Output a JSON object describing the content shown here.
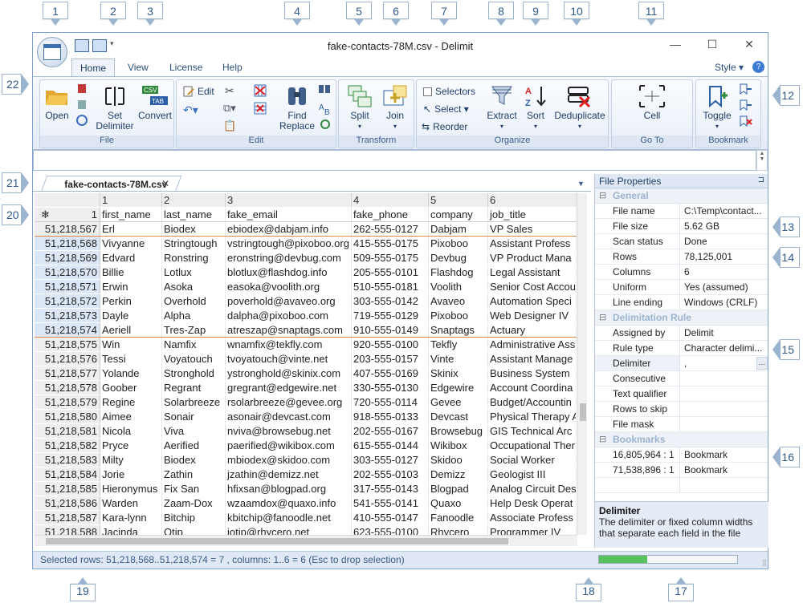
{
  "callouts": [
    "1",
    "2",
    "3",
    "4",
    "5",
    "6",
    "7",
    "8",
    "9",
    "10",
    "11",
    "12",
    "13",
    "14",
    "15",
    "16",
    "17",
    "18",
    "19",
    "20",
    "21",
    "22"
  ],
  "window": {
    "title": "fake-contacts-78M.csv - Delimit",
    "minimize": "—",
    "maximize": "☐",
    "close": "✕"
  },
  "tabs": {
    "home": "Home",
    "view": "View",
    "license": "License",
    "help": "Help",
    "style": "Style ▾",
    "help_icon": "?"
  },
  "ribbon": {
    "file": {
      "name": "File",
      "open": "Open",
      "set_delimiter_1": "Set",
      "set_delimiter_2": "Delimiter",
      "convert": "Convert"
    },
    "edit": {
      "name": "Edit",
      "edit": "Edit",
      "find_replace_1": "Find",
      "find_replace_2": "Replace"
    },
    "transform": {
      "name": "Transform",
      "split": "Split",
      "join": "Join"
    },
    "organize": {
      "name": "Organize",
      "selectors": "Selectors",
      "select": "Select ▾",
      "reorder": "Reorder",
      "extract": "Extract",
      "sort": "Sort",
      "deduplicate": "Deduplicate"
    },
    "goto": {
      "name": "Go To",
      "cell": "Cell"
    },
    "bookmark": {
      "name": "Bookmark",
      "toggle": "Toggle"
    }
  },
  "document_tab": {
    "label": "fake-contacts-78M.csv",
    "close": "✕"
  },
  "grid": {
    "col_numbers": [
      "",
      "1",
      "2",
      "3",
      "4",
      "5",
      "6"
    ],
    "header_row": {
      "num": "1",
      "cells": [
        "first_name",
        "last_name",
        "fake_email",
        "fake_phone",
        "company",
        "job_title"
      ]
    },
    "rows": [
      {
        "num": "51,218,567",
        "cells": [
          "Erl",
          "Biodex",
          "ebiodex@dabjam.info",
          "262-555-0127",
          "Dabjam",
          "VP Sales"
        ]
      },
      {
        "num": "51,218,568",
        "cells": [
          "Vivyanne",
          "Stringtough",
          "vstringtough@pixoboo.org",
          "415-555-0175",
          "Pixoboo",
          "Assistant Profess"
        ]
      },
      {
        "num": "51,218,569",
        "cells": [
          "Edvard",
          "Ronstring",
          "eronstring@devbug.com",
          "509-555-0175",
          "Devbug",
          "VP Product Mana"
        ]
      },
      {
        "num": "51,218,570",
        "cells": [
          "Billie",
          "Lotlux",
          "blotlux@flashdog.info",
          "205-555-0101",
          "Flashdog",
          "Legal Assistant"
        ]
      },
      {
        "num": "51,218,571",
        "cells": [
          "Erwin",
          "Asoka",
          "easoka@voolith.org",
          "510-555-0181",
          "Voolith",
          "Senior Cost Accou"
        ]
      },
      {
        "num": "51,218,572",
        "cells": [
          "Perkin",
          "Overhold",
          "poverhold@avaveo.org",
          "303-555-0142",
          "Avaveo",
          "Automation Speci"
        ]
      },
      {
        "num": "51,218,573",
        "cells": [
          "Dayle",
          "Alpha",
          "dalpha@pixoboo.com",
          "719-555-0129",
          "Pixoboo",
          "Web Designer IV"
        ]
      },
      {
        "num": "51,218,574",
        "cells": [
          "Aeriell",
          "Tres-Zap",
          "atreszap@snaptags.com",
          "910-555-0149",
          "Snaptags",
          "Actuary"
        ]
      },
      {
        "num": "51,218,575",
        "cells": [
          "Win",
          "Namfix",
          "wnamfix@tekfly.com",
          "920-555-0100",
          "Tekfly",
          "Administrative Ass"
        ]
      },
      {
        "num": "51,218,576",
        "cells": [
          "Tessi",
          "Voyatouch",
          "tvoyatouch@vinte.net",
          "203-555-0157",
          "Vinte",
          "Assistant Manage"
        ]
      },
      {
        "num": "51,218,577",
        "cells": [
          "Yolande",
          "Stronghold",
          "ystronghold@skinix.com",
          "407-555-0169",
          "Skinix",
          "Business System"
        ]
      },
      {
        "num": "51,218,578",
        "cells": [
          "Goober",
          "Regrant",
          "gregrant@edgewire.net",
          "330-555-0130",
          "Edgewire",
          "Account Coordina"
        ]
      },
      {
        "num": "51,218,579",
        "cells": [
          "Regine",
          "Solarbreeze",
          "rsolarbreeze@gevee.org",
          "720-555-0114",
          "Gevee",
          "Budget/Accountin"
        ]
      },
      {
        "num": "51,218,580",
        "cells": [
          "Aimee",
          "Sonair",
          "asonair@devcast.com",
          "918-555-0133",
          "Devcast",
          "Physical Therapy A"
        ]
      },
      {
        "num": "51,218,581",
        "cells": [
          "Nicola",
          "Viva",
          "nviva@browsebug.net",
          "202-555-0167",
          "Browsebug",
          "GIS Technical Arc"
        ]
      },
      {
        "num": "51,218,582",
        "cells": [
          "Pryce",
          "Aerified",
          "paerified@wikibox.com",
          "615-555-0144",
          "Wikibox",
          "Occupational Ther"
        ]
      },
      {
        "num": "51,218,583",
        "cells": [
          "Milty",
          "Biodex",
          "mbiodex@skidoo.com",
          "303-555-0127",
          "Skidoo",
          "Social Worker"
        ]
      },
      {
        "num": "51,218,584",
        "cells": [
          "Jorie",
          "Zathin",
          "jzathin@demizz.net",
          "202-555-0103",
          "Demizz",
          "Geologist III"
        ]
      },
      {
        "num": "51,218,585",
        "cells": [
          "Hieronymus",
          "Fix San",
          "hfixsan@blogpad.org",
          "317-555-0143",
          "Blogpad",
          "Analog Circuit Des"
        ]
      },
      {
        "num": "51,218,586",
        "cells": [
          "Warden",
          "Zaam-Dox",
          "wzaamdox@quaxo.info",
          "541-555-0141",
          "Quaxo",
          "Help Desk Operat"
        ]
      },
      {
        "num": "51,218,587",
        "cells": [
          "Kara-lynn",
          "Bitchip",
          "kbitchip@fanoodle.net",
          "410-555-0147",
          "Fanoodle",
          "Associate Profess"
        ]
      },
      {
        "num": "51,218,588",
        "cells": [
          "Jacinda",
          "Otip",
          "jotip@rhycero.net",
          "623-555-0100",
          "Rhycero",
          "Programmer IV"
        ]
      }
    ]
  },
  "properties": {
    "title": "File Properties",
    "pin": "⊐",
    "general": {
      "label": "General",
      "items": [
        [
          "File name",
          "C:\\Temp\\contact..."
        ],
        [
          "File size",
          "5.62 GB"
        ],
        [
          "Scan status",
          "Done"
        ],
        [
          "Rows",
          "78,125,001"
        ],
        [
          "Columns",
          "6"
        ],
        [
          "Uniform",
          "Yes (assumed)"
        ],
        [
          "Line ending",
          "Windows (CRLF)"
        ]
      ]
    },
    "rule": {
      "label": "Delimitation Rule",
      "items": [
        [
          "Assigned by",
          "Delimit"
        ],
        [
          "Rule type",
          "Character delimi..."
        ],
        [
          "Delimiter",
          ","
        ],
        [
          "Consecutive",
          ""
        ],
        [
          "Text qualifier",
          ""
        ],
        [
          "Rows to skip",
          ""
        ],
        [
          "File mask",
          ""
        ]
      ]
    },
    "bookmarks": {
      "label": "Bookmarks",
      "items": [
        [
          "16,805,964 : 1",
          "Bookmark"
        ],
        [
          "71,538,896 : 1",
          "Bookmark"
        ]
      ]
    },
    "desc_title": "Delimiter",
    "desc_text": "The delimiter or fixed column widths that separate each field in the file"
  },
  "status": {
    "text": "Selected rows: 51,218,568..51,218,574 = 7 , columns: 1..6 = 6   (Esc to drop selection)",
    "progress": 0.35
  }
}
